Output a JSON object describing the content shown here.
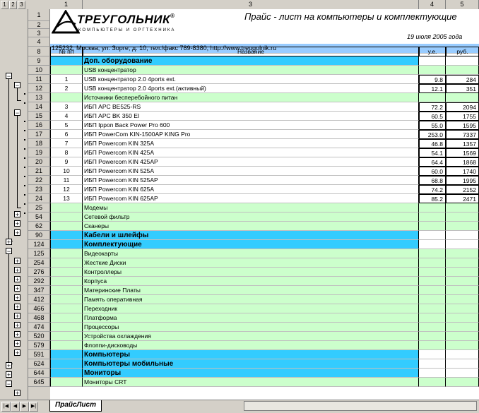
{
  "outline_levels": [
    "1",
    "2",
    "3"
  ],
  "columns": [
    "1",
    "3",
    "4",
    "5"
  ],
  "header": {
    "logo_name": "ТРЕУГОЛЬНИК",
    "logo_reg": "®",
    "logo_sub": "КОМПЬЮТЕРЫ И ОРГТЕХНИКА",
    "title": "Прайс - лист на компьютеры и комплектующие",
    "date": "19 июля  2005 года",
    "address": "125232, Москва, ул. Зорге, д. 10, тел./факс 789-8380,  http://www.treugolnik.ru"
  },
  "table_headers": {
    "num": "№ пп",
    "name": "Название",
    "usd": "у.е.",
    "rub": "руб."
  },
  "rows": [
    {
      "row": "1"
    },
    {
      "row": "2"
    },
    {
      "row": "3"
    },
    {
      "row": "4"
    },
    {
      "row": "8"
    },
    {
      "row": "9",
      "name": "Доп. оборудование",
      "style": "cat"
    },
    {
      "row": "10",
      "name": "USB концентратор",
      "style": "sub"
    },
    {
      "row": "11",
      "num": "1",
      "name": "USB концентратор  2.0 4ports ext.",
      "usd": "9.8",
      "rub": "284",
      "style": "item"
    },
    {
      "row": "12",
      "num": "2",
      "name": "USB концентратор  2.0 4ports ext.(активный)",
      "usd": "12.1",
      "rub": "351",
      "style": "item"
    },
    {
      "row": "13",
      "name": "Источники бесперебойного питан",
      "style": "sub"
    },
    {
      "row": "14",
      "num": "3",
      "name": "ИБП APC BE525-RS",
      "usd": "72.2",
      "rub": "2094",
      "style": "item"
    },
    {
      "row": "15",
      "num": "4",
      "name": "ИБП APC BK 350 EI",
      "usd": "60.5",
      "rub": "1755",
      "style": "item"
    },
    {
      "row": "16",
      "num": "5",
      "name": "ИБП Ippon Back Power Pro 600",
      "usd": "55.0",
      "rub": "1595",
      "style": "item"
    },
    {
      "row": "17",
      "num": "6",
      "name": "ИБП PowerCom  KIN-1500AP KING Pro",
      "usd": "253.0",
      "rub": "7337",
      "style": "item"
    },
    {
      "row": "18",
      "num": "7",
      "name": "ИБП Powercom KIN 325A",
      "usd": "46.8",
      "rub": "1357",
      "style": "item"
    },
    {
      "row": "19",
      "num": "8",
      "name": "ИБП Powercom KIN 425A",
      "usd": "54.1",
      "rub": "1569",
      "style": "item"
    },
    {
      "row": "20",
      "num": "9",
      "name": "ИБП Powercom KIN 425AP",
      "usd": "64.4",
      "rub": "1868",
      "style": "item"
    },
    {
      "row": "21",
      "num": "10",
      "name": "ИБП Powercom KIN 525A",
      "usd": "60.0",
      "rub": "1740",
      "style": "item"
    },
    {
      "row": "22",
      "num": "11",
      "name": "ИБП Powercom KIN 525AP",
      "usd": "68.8",
      "rub": "1995",
      "style": "item"
    },
    {
      "row": "23",
      "num": "12",
      "name": "ИБП Powercom KIN 625A",
      "usd": "74.2",
      "rub": "2152",
      "style": "item"
    },
    {
      "row": "24",
      "num": "13",
      "name": "ИБП Powercom KIN 625AP",
      "usd": "85.2",
      "rub": "2471",
      "style": "item"
    },
    {
      "row": "25",
      "name": "Модемы",
      "style": "sub"
    },
    {
      "row": "54",
      "name": "Сетевой фильтр",
      "style": "sub"
    },
    {
      "row": "62",
      "name": "Сканеры",
      "style": "sub"
    },
    {
      "row": "90",
      "name": "Кабели и шлейфы",
      "style": "cat"
    },
    {
      "row": "124",
      "name": "Комплектующие",
      "style": "cat"
    },
    {
      "row": "125",
      "name": "Видеокарты",
      "style": "sub"
    },
    {
      "row": "254",
      "name": "Жесткие Диски",
      "style": "sub"
    },
    {
      "row": "276",
      "name": "Контроллеры",
      "style": "sub"
    },
    {
      "row": "292",
      "name": "Корпуса",
      "style": "sub"
    },
    {
      "row": "347",
      "name": "Материнские Платы",
      "style": "sub"
    },
    {
      "row": "412",
      "name": "Память оперативная",
      "style": "sub"
    },
    {
      "row": "466",
      "name": "Переходник",
      "style": "sub"
    },
    {
      "row": "468",
      "name": "Платформа",
      "style": "sub"
    },
    {
      "row": "474",
      "name": "Процессоры",
      "style": "sub"
    },
    {
      "row": "520",
      "name": "Устройства охлаждения",
      "style": "sub"
    },
    {
      "row": "579",
      "name": "Флоппи-дисководы",
      "style": "sub"
    },
    {
      "row": "591",
      "name": "Компьютеры",
      "style": "cat"
    },
    {
      "row": "624",
      "name": "Компьютеры мобильные",
      "style": "cat"
    },
    {
      "row": "644",
      "name": "Мониторы",
      "style": "cat"
    },
    {
      "row": "645",
      "name": "Мониторы CRT",
      "style": "sub"
    }
  ],
  "sheet_tab": "ПрайсЛист",
  "colors": {
    "cyan": "#33ccff",
    "green": "#ccffcc",
    "blue_band": "#99ccff"
  }
}
